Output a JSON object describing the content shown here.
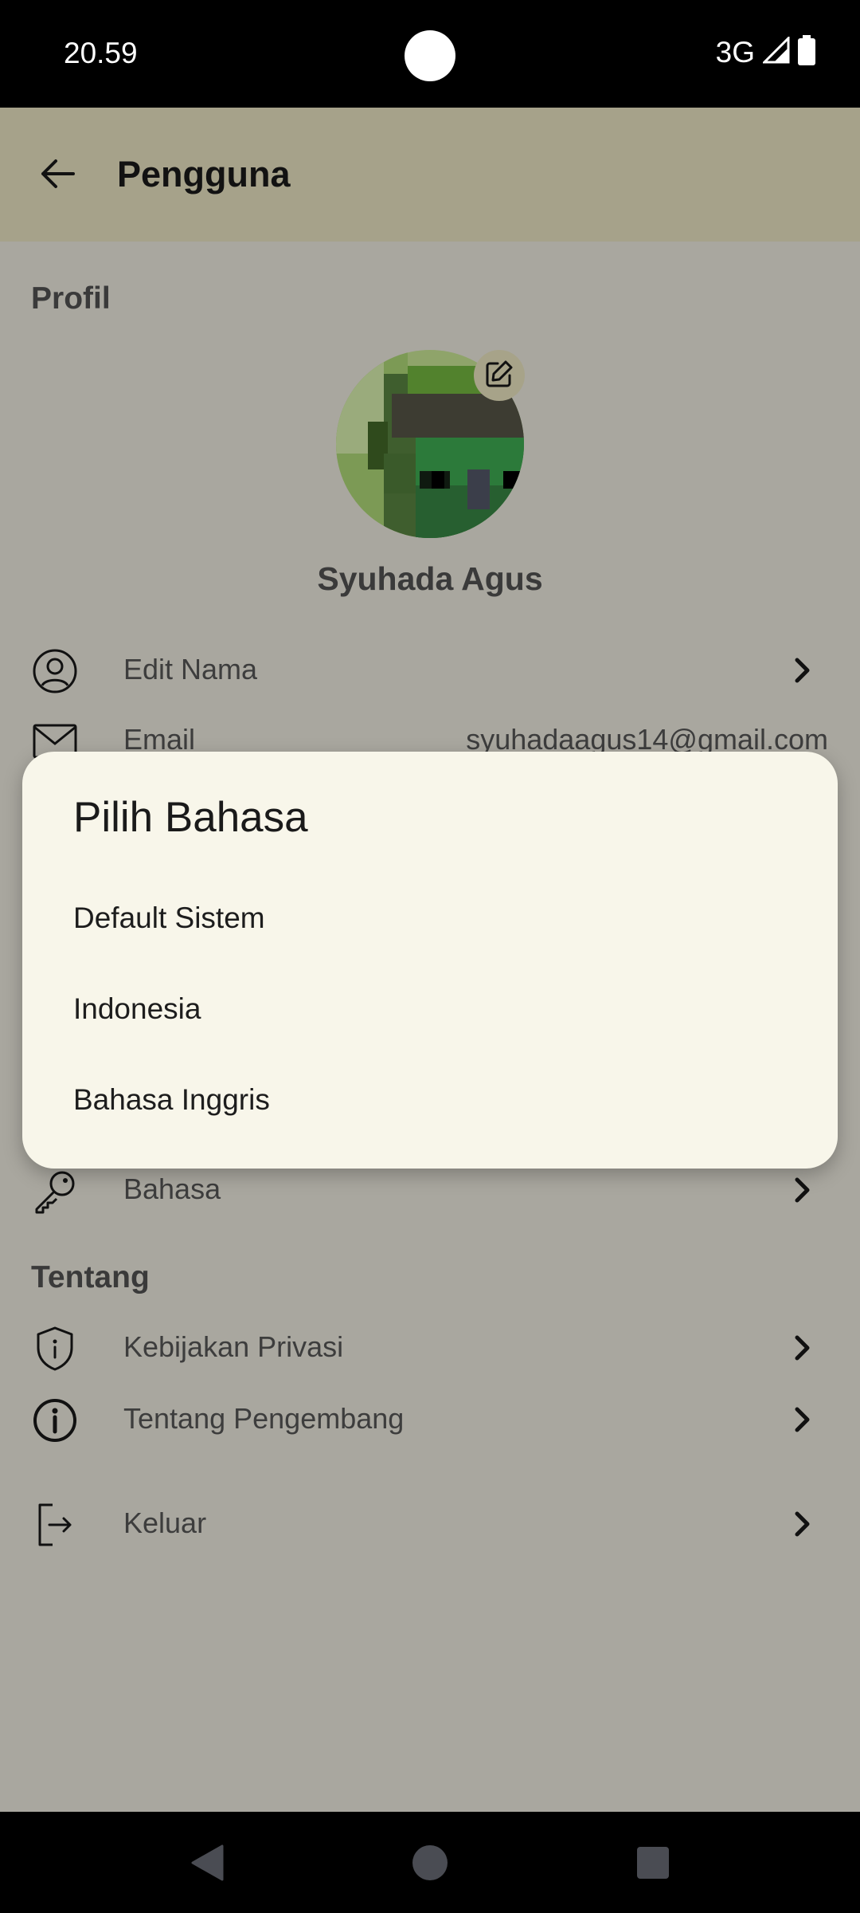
{
  "status_bar": {
    "time": "20.59",
    "network": "3G",
    "icons": [
      "signal-icon",
      "battery-icon"
    ]
  },
  "app_bar": {
    "title": "Pengguna",
    "back_icon": "arrow-left-icon"
  },
  "profile": {
    "section_title": "Profil",
    "user_name": "Syuhada Agus",
    "edit_avatar_icon": "edit-icon"
  },
  "rows": {
    "edit_name": {
      "label": "Edit Nama",
      "icon": "user-circle-icon"
    },
    "email": {
      "label": "Email",
      "value": "syuhadaagus14@gmail.com",
      "icon": "mail-icon"
    },
    "language": {
      "label": "Bahasa",
      "icon": "key-icon"
    }
  },
  "about": {
    "section_title": "Tentang",
    "privacy": {
      "label": "Kebijakan Privasi",
      "icon": "shield-icon"
    },
    "developer": {
      "label": "Tentang Pengembang",
      "icon": "info-icon"
    }
  },
  "logout": {
    "label": "Keluar",
    "icon": "logout-icon"
  },
  "dialog": {
    "title": "Pilih Bahasa",
    "options": [
      "Default Sistem",
      "Indonesia",
      "Bahasa Inggris"
    ]
  },
  "colors": {
    "app_bar": "#a6a28a",
    "scrim_background": "#a9a79f",
    "dialog_background": "#f8f6ea"
  }
}
